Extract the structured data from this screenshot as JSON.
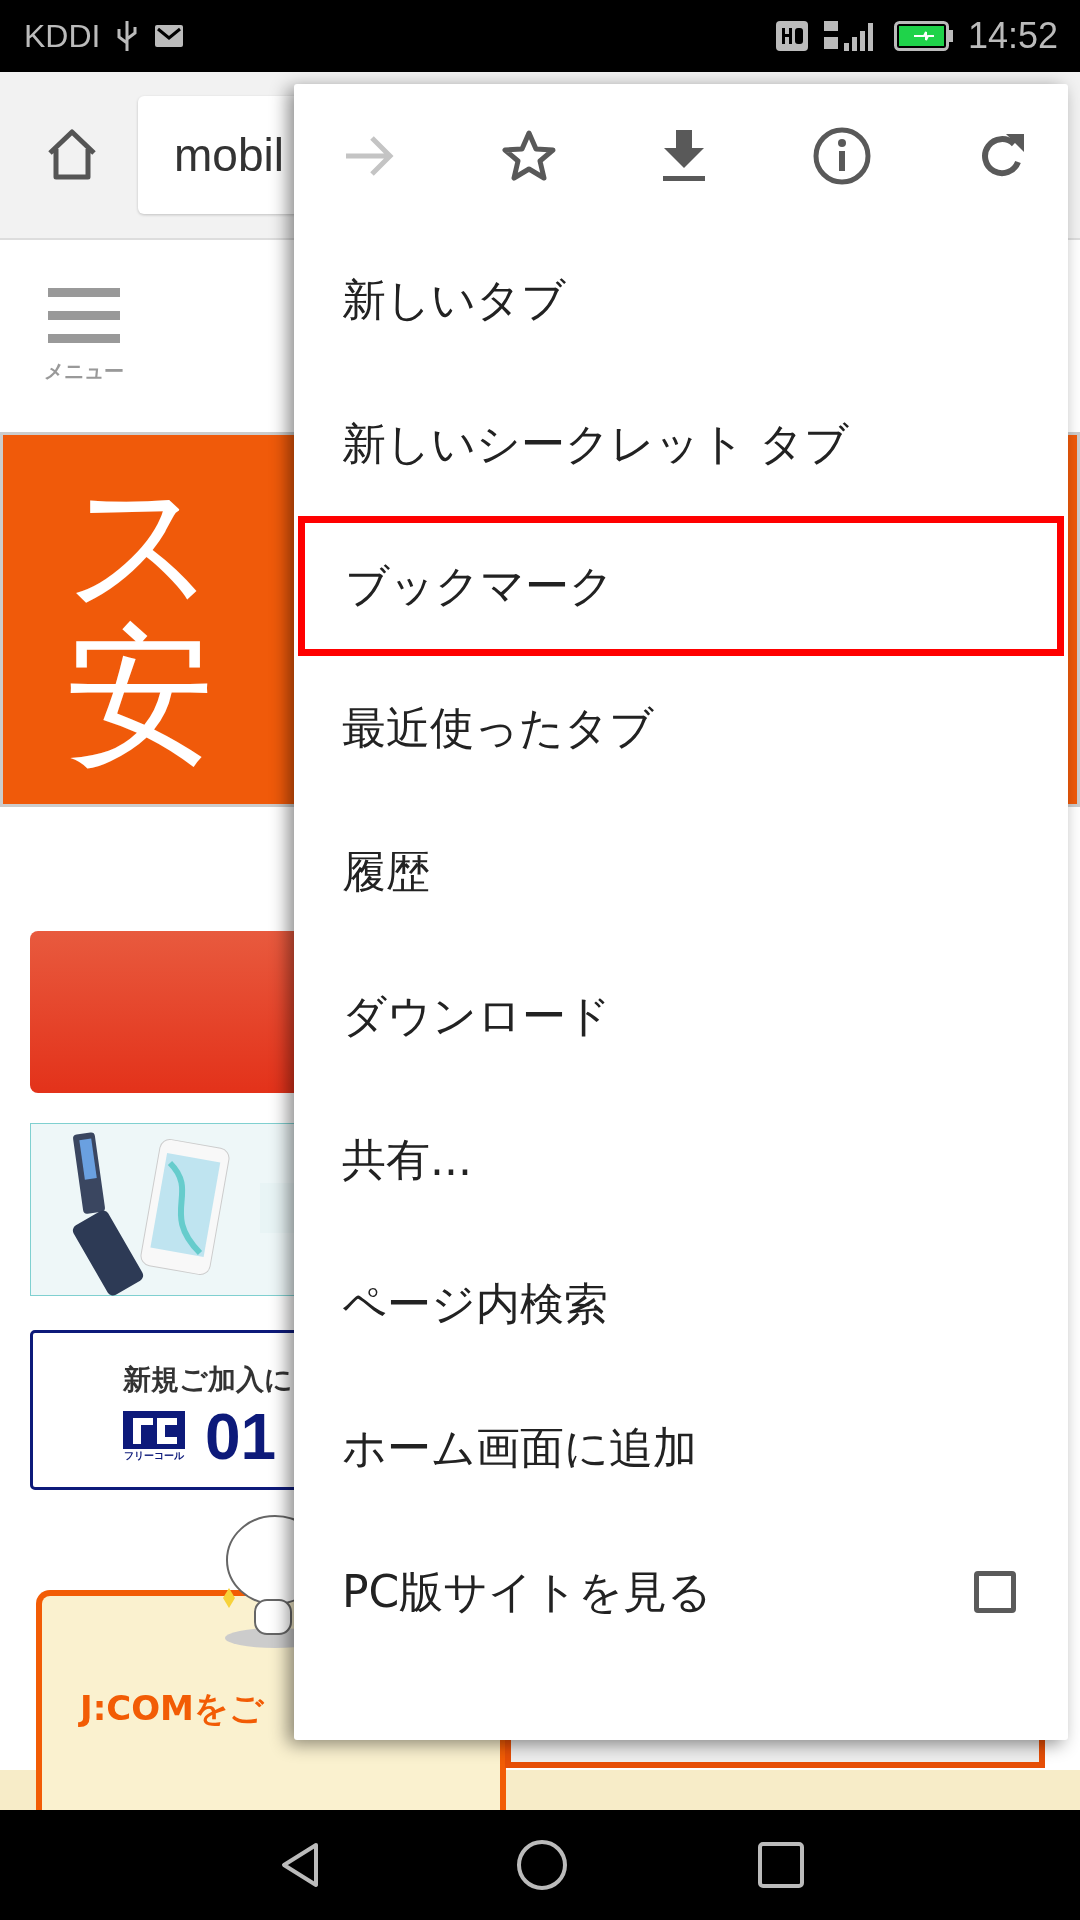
{
  "status_bar": {
    "carrier": "KDDI",
    "time": "14:52"
  },
  "toolbar": {
    "url": "mobil"
  },
  "page": {
    "menu_label": "メニュー",
    "banner_lines": [
      "ス",
      "安"
    ],
    "signup_text": "新規ご加入に",
    "phone_number": "01",
    "freecall_label": "フリーコール",
    "promo_text": "J:COMをご"
  },
  "menu": {
    "actions": [
      {
        "kind": "forward",
        "disabled": true
      },
      {
        "kind": "bookmark",
        "disabled": false
      },
      {
        "kind": "download",
        "disabled": false
      },
      {
        "kind": "info",
        "disabled": false
      },
      {
        "kind": "reload",
        "disabled": false
      }
    ],
    "items": [
      {
        "label": "新しいタブ",
        "kind": "plain",
        "highlighted": false
      },
      {
        "label": "新しいシークレット タブ",
        "kind": "plain",
        "highlighted": false
      },
      {
        "label": "ブックマーク",
        "kind": "plain",
        "highlighted": true
      },
      {
        "label": "最近使ったタブ",
        "kind": "plain",
        "highlighted": false
      },
      {
        "label": "履歴",
        "kind": "plain",
        "highlighted": false
      },
      {
        "label": "ダウンロード",
        "kind": "plain",
        "highlighted": false
      },
      {
        "label": "共有...",
        "kind": "plain",
        "highlighted": false
      },
      {
        "label": "ページ内検索",
        "kind": "plain",
        "highlighted": false
      },
      {
        "label": "ホーム画面に追加",
        "kind": "plain",
        "highlighted": false
      },
      {
        "label": "PC版サイトを見る",
        "kind": "checkbox",
        "highlighted": false,
        "checked": false
      }
    ]
  }
}
